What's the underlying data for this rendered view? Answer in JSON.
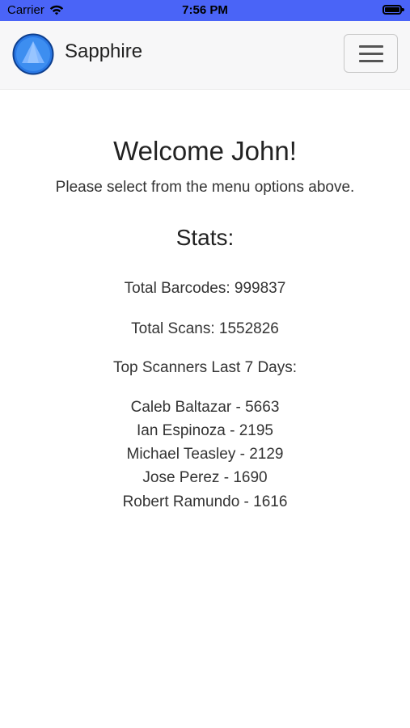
{
  "status_bar": {
    "carrier": "Carrier",
    "time": "7:56 PM"
  },
  "navbar": {
    "brand": "Sapphire",
    "menu_icon": "hamburger-menu-icon",
    "logo_icon": "sapphire-triangle-logo"
  },
  "main": {
    "welcome": "Welcome John!",
    "subtitle": "Please select from the menu options above.",
    "stats_title": "Stats:",
    "total_barcodes": "Total Barcodes: 999837",
    "total_scans": "Total Scans: 1552826",
    "top_scanners_title": "Top Scanners Last 7 Days:",
    "top_scanners": [
      "Caleb Baltazar - 5663",
      "Ian Espinoza - 2195",
      "Michael Teasley - 2129",
      "Jose Perez - 1690",
      "Robert Ramundo - 1616"
    ]
  },
  "colors": {
    "status_bar": "#4a64f7",
    "logo_blue": "#1f6fe0"
  }
}
